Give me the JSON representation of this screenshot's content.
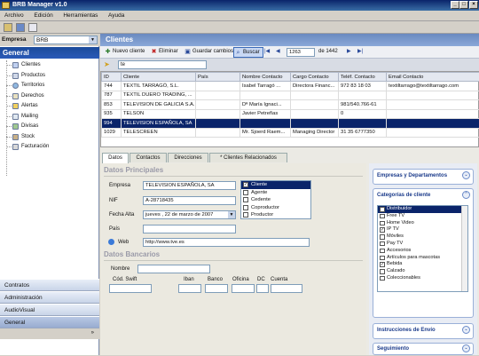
{
  "window": {
    "title": "BRB Manager v1.0",
    "min": "_",
    "max": "□",
    "close": "×"
  },
  "menu": [
    "Archivo",
    "Edición",
    "Herramientas",
    "Ayuda"
  ],
  "empresa": {
    "label": "Empresa",
    "value": "BRB"
  },
  "sidebar": {
    "header": "General",
    "items": [
      {
        "label": "Clientes"
      },
      {
        "label": "Productos"
      },
      {
        "label": "Territorios"
      },
      {
        "label": "Derechos"
      },
      {
        "label": "Alertas"
      },
      {
        "label": "Mailing"
      },
      {
        "label": "Divisas"
      },
      {
        "label": "Stock"
      },
      {
        "label": "Facturación"
      }
    ],
    "sections": [
      "Contratos",
      "Administración",
      "AudioVisual",
      "General"
    ]
  },
  "main": {
    "title": "Clientes",
    "toolbar": {
      "new": "Nuevo cliente",
      "delete": "Eliminar",
      "save": "Guardar cambios",
      "search": "Buscar",
      "record": "1263",
      "of": "de 1442"
    },
    "filter": "te",
    "columns": [
      "ID",
      "Cliente",
      "País",
      "Nombre Contacto",
      "Cargo Contacto",
      "Teléf. Contacto",
      "Email Contacto"
    ],
    "rows": [
      [
        "744",
        "TEXTIL TARRAGÓ, S.L.",
        "",
        "Isabel Tarragó ...",
        "Directora Financ...",
        "972 83 18 03",
        "textiltarrago@textiltarrago.com"
      ],
      [
        "787",
        "TEXTIL DUERO TRADING, ...",
        "",
        "",
        "",
        "",
        ""
      ],
      [
        "853",
        "TELEVISION DE GALICIA S.A.",
        "",
        "Dª María Ignaci...",
        "",
        "981/540.766-61",
        ""
      ],
      [
        "935",
        "TELSON",
        "",
        "Javier Petreñas",
        "",
        "0",
        ""
      ],
      [
        "994",
        "TELEVISION ESPAÑOLA, SA",
        "",
        "",
        "",
        "",
        ""
      ],
      [
        "1029",
        "TELESCREEN",
        "",
        "Mr. Sjoerd Raem...",
        "Managing Director",
        "31 35 6777350",
        ""
      ]
    ],
    "selected_row": 4,
    "tabs": [
      "Datos",
      "Contactos",
      "Direcciones",
      "* Clientes Relacionados"
    ]
  },
  "detail": {
    "principales": "Datos Principales",
    "empresa_label": "Empresa",
    "empresa": "TELEVISION ESPAÑOLA, SA",
    "nif_label": "NIF",
    "nif": "A-28718435",
    "fecha_label": "Fecha Alta",
    "fecha": "jueves , 22 de marzo de 2007",
    "pais_label": "País",
    "pais": "",
    "web_label": "Web",
    "web": "http://www.tve.es",
    "tipos": [
      {
        "label": "Cliente",
        "checked": true
      },
      {
        "label": "Agente",
        "checked": false
      },
      {
        "label": "Cedente",
        "checked": false
      },
      {
        "label": "Coproductor",
        "checked": false
      },
      {
        "label": "Productor",
        "checked": false
      }
    ],
    "bancarios": "Datos Bancarios",
    "nombre_label": "Nombre",
    "bank_fields": [
      "Cód. Swift",
      "Iban",
      "Banco",
      "Oficina",
      "DC",
      "Cuenta"
    ]
  },
  "right": {
    "panels": [
      "Empresas y Departamentos",
      "Categorías de cliente",
      "Instrucciones de Envío",
      "Seguimiento"
    ],
    "categorias": [
      {
        "label": "Distribuidor",
        "checked": true
      },
      {
        "label": "Free TV",
        "checked": false
      },
      {
        "label": "Home Video",
        "checked": false
      },
      {
        "label": "IP TV",
        "checked": true
      },
      {
        "label": "Móviles",
        "checked": false
      },
      {
        "label": "Pay TV",
        "checked": false
      },
      {
        "label": "Accesorios",
        "checked": false
      },
      {
        "label": "Artículos para mascotas",
        "checked": false
      },
      {
        "label": "Bebida",
        "checked": true
      },
      {
        "label": "Calzado",
        "checked": false
      },
      {
        "label": "Coleccionables",
        "checked": false
      }
    ]
  }
}
